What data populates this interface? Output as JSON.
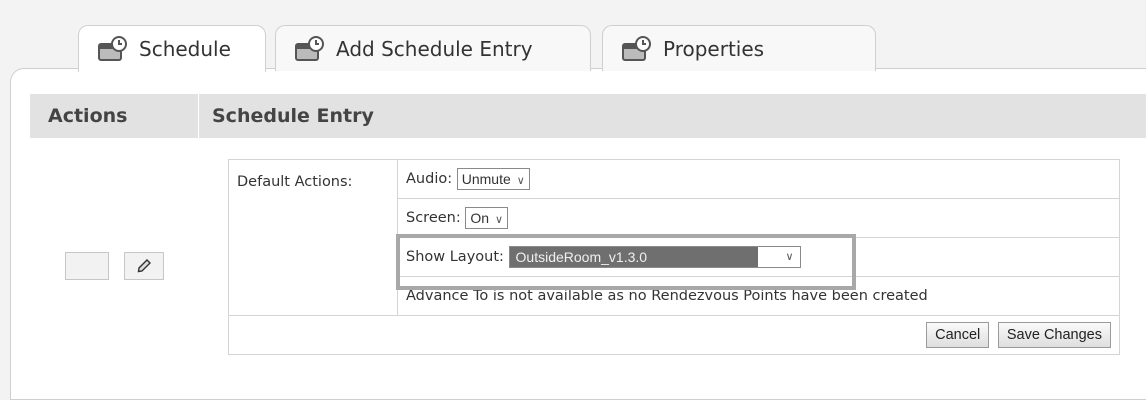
{
  "tabs": [
    {
      "label": "Schedule",
      "icon": "calendar-icon"
    },
    {
      "label": "Add Schedule Entry",
      "icon": "calendar-icon"
    },
    {
      "label": "Properties",
      "icon": "calendar-icon"
    }
  ],
  "header": {
    "actions_label": "Actions",
    "entry_label": "Schedule Entry"
  },
  "entry": {
    "default_actions_label": "Default Actions:",
    "audio": {
      "label": "Audio:",
      "value": "Unmute"
    },
    "screen": {
      "label": "Screen:",
      "value": "On"
    },
    "layout": {
      "label": "Show Layout:",
      "value": "OutsideRoom_v1.3.0"
    },
    "advance_note": "Advance To is not available as no Rendezvous Points have been created",
    "cancel_label": "Cancel",
    "save_label": "Save Changes"
  }
}
